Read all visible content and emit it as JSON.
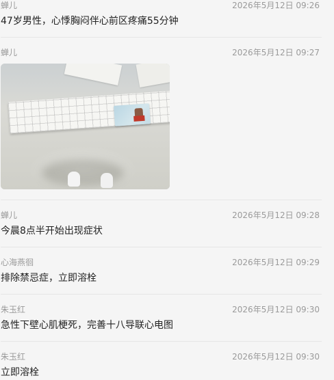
{
  "messages": [
    {
      "sender": "蝉儿",
      "time": "2026年5月12日 09:26",
      "type": "text",
      "text": "47岁男性，心悸胸闷伴心前区疼痛55分钟"
    },
    {
      "sender": "蝉儿",
      "time": "2026年5月12日 09:27",
      "type": "image",
      "image_desc": "ecg-strip-and-id-card-photo"
    },
    {
      "sender": "蝉儿",
      "time": "2026年5月12日 09:28",
      "type": "text",
      "text": "今晨8点半开始出现症状"
    },
    {
      "sender": "心海燕徊",
      "time": "2026年5月12日 09:29",
      "type": "text",
      "text": "排除禁忌症，立即溶栓"
    },
    {
      "sender": "朱玉红",
      "time": "2026年5月12日 09:30",
      "type": "text",
      "text": "急性下壁心肌梗死，完善十八导联心电图"
    },
    {
      "sender": "朱玉红",
      "time": "2026年5月12日 09:30",
      "type": "text",
      "text": "立即溶栓"
    }
  ],
  "colors": {
    "background": "#f5f5f5",
    "meta_text": "#9a9a9a",
    "body_text": "#222222",
    "divider": "#e6e6e6"
  }
}
